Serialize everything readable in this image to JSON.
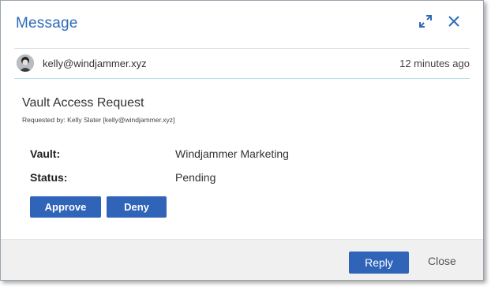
{
  "dialog": {
    "title": "Message",
    "expand_icon": "expand-arrows-icon",
    "close_icon": "close-x-icon"
  },
  "sender": {
    "email": "kelly@windjammer.xyz",
    "time": "12 minutes ago"
  },
  "request": {
    "title": "Vault Access Request",
    "requested_by": "Requested by: Kelly Slater [kelly@windjammer.xyz]",
    "fields": [
      {
        "label": "Vault:",
        "value": "Windjammer Marketing"
      },
      {
        "label": "Status:",
        "value": "Pending"
      }
    ],
    "approve_label": "Approve",
    "deny_label": "Deny"
  },
  "footer": {
    "reply_label": "Reply",
    "close_label": "Close"
  },
  "colors": {
    "accent": "#2e6bb8",
    "button": "#2f64b9",
    "footer_bg": "#f0f0f0"
  }
}
